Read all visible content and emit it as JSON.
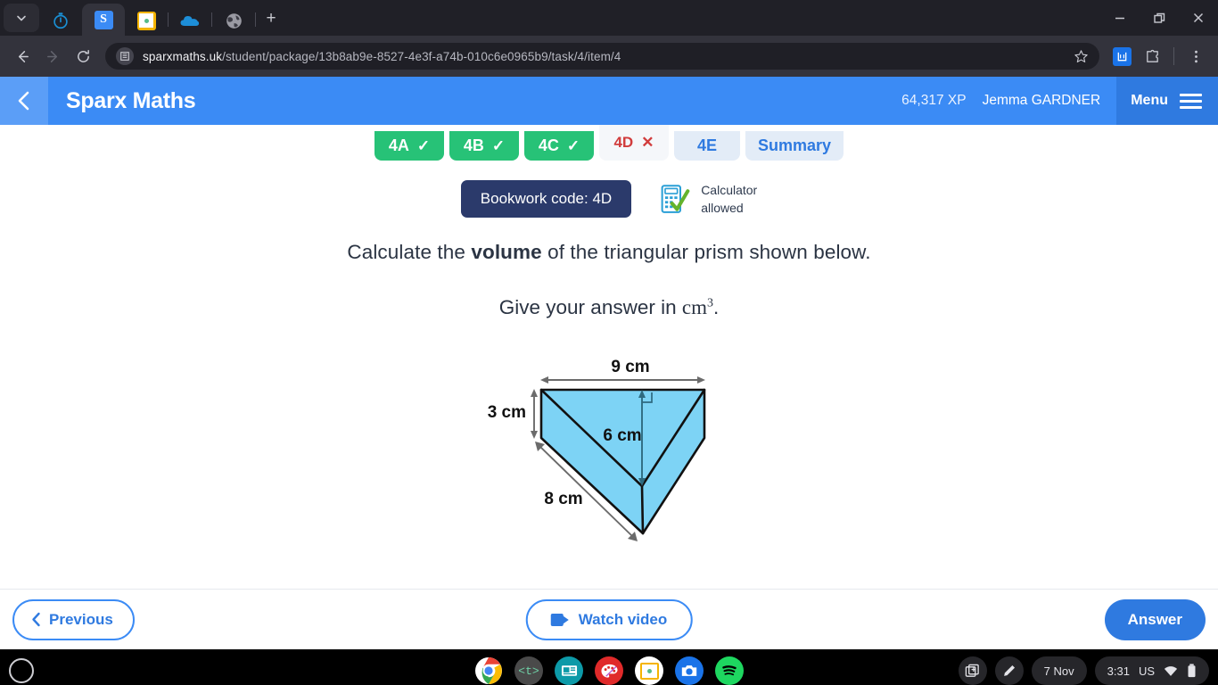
{
  "browser": {
    "tabs": [
      {
        "name": "tab-chevron",
        "icon": "chevron-down-icon"
      },
      {
        "name": "tab-timer",
        "icon": "stopwatch-icon",
        "active": false
      },
      {
        "name": "tab-sparx",
        "icon": "sparx-s-icon",
        "active": true
      },
      {
        "name": "tab-classroom",
        "icon": "google-classroom-icon",
        "active": false
      },
      {
        "name": "tab-onedrive",
        "icon": "cloud-icon",
        "active": false
      },
      {
        "name": "tab-globe",
        "icon": "globe-icon",
        "active": false
      }
    ],
    "new_tab_label": "+",
    "window_controls": {
      "minimize": "–",
      "restore": "❐",
      "close": "✕"
    },
    "nav": {
      "back": "←",
      "forward": "→",
      "reload": "↻"
    },
    "url_prefix": "sparxmaths.uk",
    "url_path": "/student/package/13b8ab9e-8527-4e3f-a74b-010c6e0965b9/task/4/item/4",
    "url_full": "sparxmaths.uk/student/package/13b8ab9e-8527-4e3f-a74b-010c6e0965b9/task/4/item/4",
    "bookmark_icon": "star-icon",
    "extension_icon": "extension-icon",
    "menu_icon": "kebab-menu-icon"
  },
  "header": {
    "back_icon": "chevron-left-icon",
    "title": "Sparx Maths",
    "xp": "64,317 XP",
    "user": "Jemma GARDNER",
    "menu_label": "Menu"
  },
  "tabs": [
    {
      "label": "4A",
      "state": "done",
      "mark": "✓"
    },
    {
      "label": "4B",
      "state": "done",
      "mark": "✓"
    },
    {
      "label": "4C",
      "state": "done",
      "mark": "✓"
    },
    {
      "label": "4D",
      "state": "current",
      "mark": "✕"
    },
    {
      "label": "4E",
      "state": "future",
      "mark": ""
    },
    {
      "label": "Summary",
      "state": "future",
      "mark": ""
    }
  ],
  "meta": {
    "bookwork_label": "Bookwork code: 4D",
    "calculator_icon": "calculator-allowed-icon",
    "calculator_line1": "Calculator",
    "calculator_line2": "allowed"
  },
  "question": {
    "line1_part1": "Calculate the ",
    "line1_bold": "volume",
    "line1_part2": " of the triangular prism shown below.",
    "line2_part1": "Give your answer in ",
    "line2_unit": "cm",
    "line2_exponent": "3",
    "line2_end": "."
  },
  "diagram": {
    "type": "triangular-prism",
    "fill_color": "#7dd3f5",
    "stroke_color": "#111111",
    "dimension_color": "#6b6b6b",
    "labels": {
      "top": "9 cm",
      "left": "3 cm",
      "height": "6 cm",
      "depth": "8 cm"
    },
    "right_angle_marker": true
  },
  "footer": {
    "previous_label": "Previous",
    "previous_icon": "chevron-left-icon",
    "watch_label": "Watch video",
    "watch_icon": "video-camera-icon",
    "answer_label": "Answer"
  },
  "taskbar": {
    "launcher_icon": "launcher-circle-icon",
    "apps": [
      {
        "name": "chrome-icon",
        "active": true
      },
      {
        "name": "t-bracket-icon",
        "active": false
      },
      {
        "name": "news-app-icon",
        "active": false
      },
      {
        "name": "paint-palette-icon",
        "active": false
      },
      {
        "name": "google-classroom-icon",
        "active": true
      },
      {
        "name": "camera-icon",
        "active": false
      },
      {
        "name": "spotify-icon",
        "active": false
      }
    ],
    "screenshot_icon": "screen-capture-icon",
    "stylus_icon": "pen-icon",
    "date": "7 Nov",
    "time": "3:31",
    "locale": "US",
    "wifi_icon": "wifi-icon",
    "battery_icon": "battery-icon"
  },
  "colors": {
    "sparx_blue": "#3b8bf5",
    "sparx_menu_blue": "#2f7ae0",
    "done_green": "#27c277",
    "current_red": "#d13c3c",
    "bookwork_navy": "#2b3a6b"
  }
}
